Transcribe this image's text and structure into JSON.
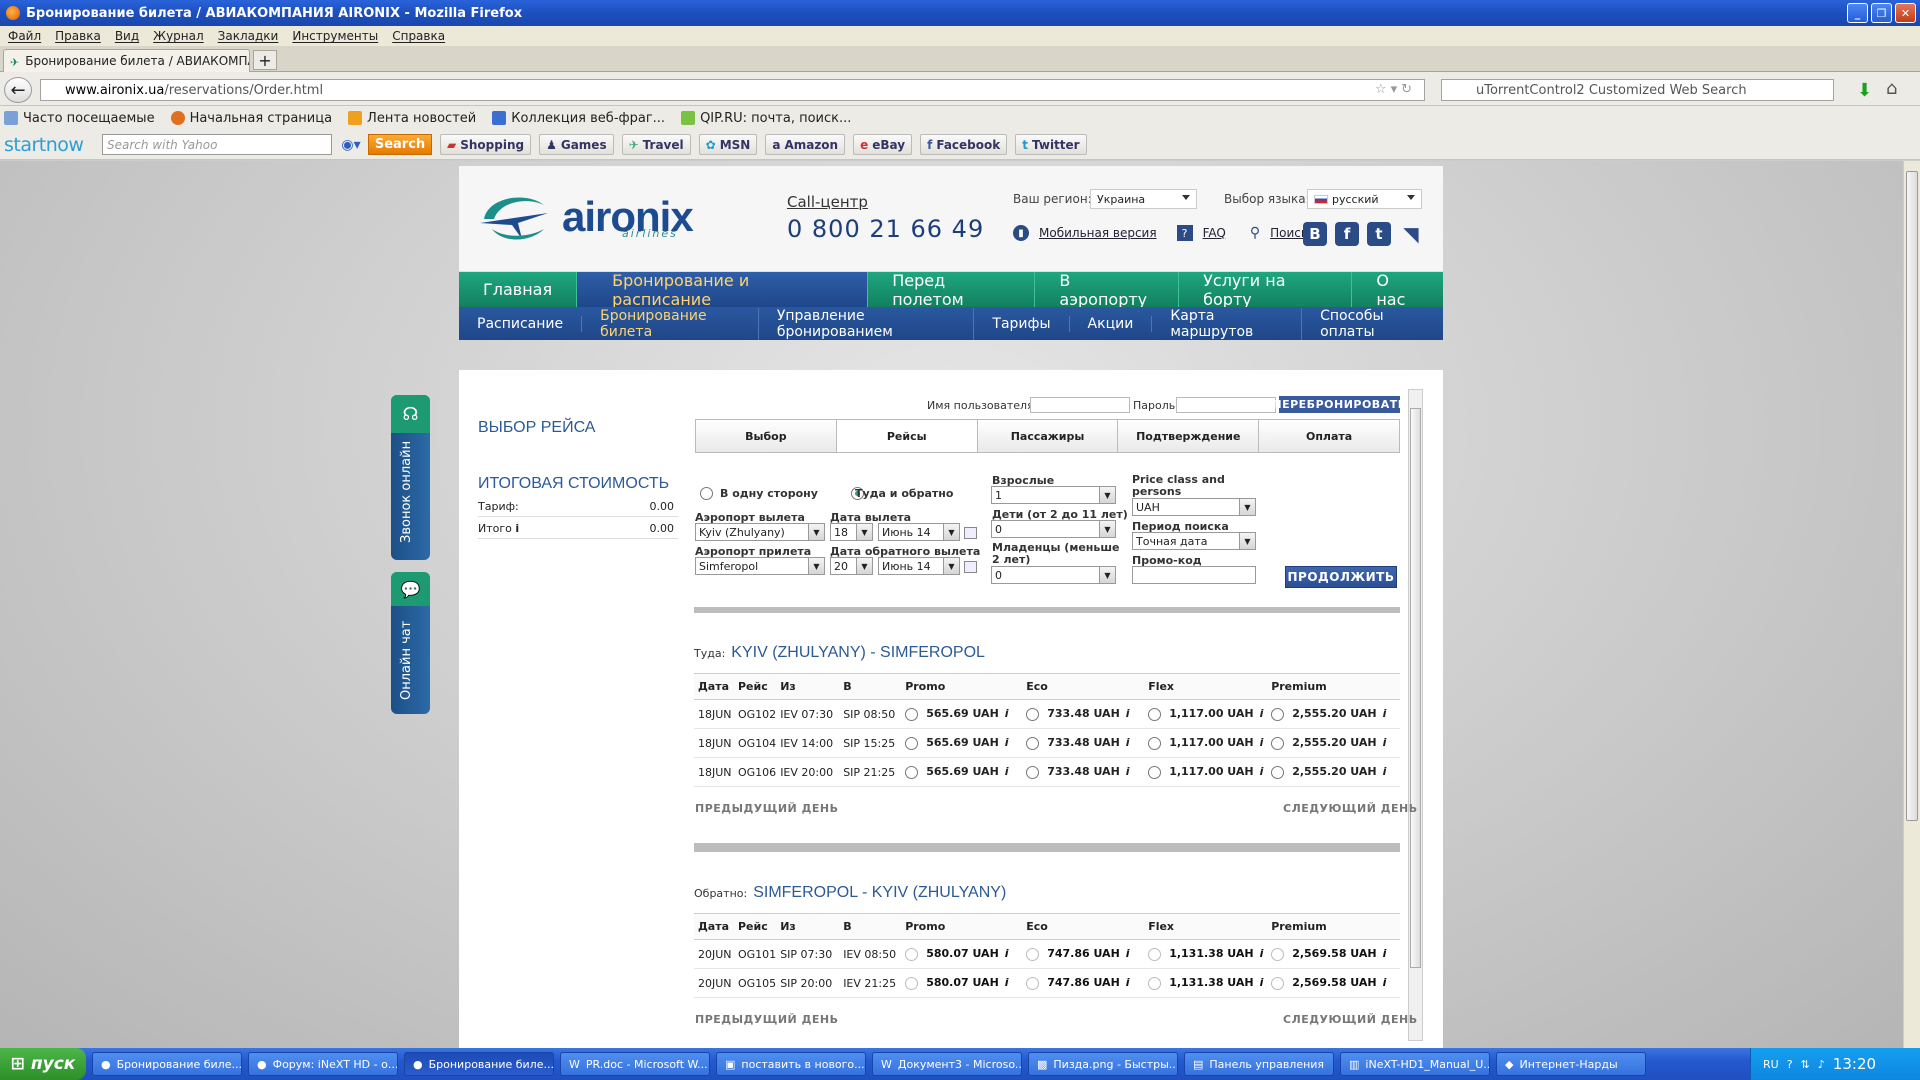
{
  "window": {
    "title": "Бронирование билета / АВИАКОМПАНИЯ AIRONIX - Mozilla Firefox"
  },
  "menu": [
    "Файл",
    "Правка",
    "Вид",
    "Журнал",
    "Закладки",
    "Инструменты",
    "Справка"
  ],
  "tab": {
    "label": "Бронирование билета / АВИАКОМПАНИЯ ..."
  },
  "address": {
    "domain": "www.aironix.ua",
    "path": "/reservations/Order.html"
  },
  "search": {
    "placeholder": "uTorrentControl2 Customized Web Search"
  },
  "bookmarks": [
    "Часто посещаемые",
    "Начальная страница",
    "Лента новостей",
    "Коллекция веб-фраг...",
    "QIP.RU: почта, поиск..."
  ],
  "startnow": {
    "logo": "startnow",
    "placeholder": "Search with Yahoo",
    "button": "Search",
    "links": [
      "Shopping",
      "Games",
      "Travel",
      "MSN",
      "Amazon",
      "eBay",
      "Facebook",
      "Twitter"
    ]
  },
  "site": {
    "logo": "aironix",
    "logo_sub": "airlines",
    "call_label": "Call-центр",
    "phone": "0 800 21 66 49",
    "region_label": "Ваш регион:",
    "region_value": "Украина",
    "lang_label": "Выбор языка:",
    "lang_value": "русский",
    "mobile": "Мобильная версия",
    "faq": "FAQ",
    "search": "Поиск",
    "main_menu": [
      "Главная",
      "Бронирование и расписание",
      "Перед полетом",
      "В аэропорту",
      "Услуги на борту",
      "О нас"
    ],
    "sub_menu": [
      "Расписание",
      "Бронирование билета",
      "Управление бронированием",
      "Тарифы",
      "Акции",
      "Карта маршрутов",
      "Способы оплаты"
    ]
  },
  "side": {
    "call": "Звонок онлайн",
    "chat": "Онлайн чат"
  },
  "booking": {
    "title": "ВЫБОР РЕЙСА",
    "total_title": "ИТОГОВАЯ СТОИМОСТЬ",
    "tariff_label": "Тариф:",
    "tariff_value": "0.00",
    "total_label": "Итого",
    "total_value": "0.00",
    "username_label": "Имя пользователя",
    "password_label": "Пароль",
    "rebook": "ПЕРЕБРОНИРОВАТЬ",
    "steps": [
      "Выбор",
      "Рейсы",
      "Пассажиры",
      "Подтверждение",
      "Оплата"
    ],
    "one_way": "В одну сторону",
    "round_trip": "Туда и обратно",
    "dep_airport_label": "Аэропорт вылета",
    "dep_airport": "Kyiv (Zhulyany)",
    "dep_date_label": "Дата вылета",
    "dep_day": "18",
    "dep_month": "Июнь 14",
    "arr_airport_label": "Аэропорт прилета",
    "arr_airport": "Simferopol",
    "ret_date_label": "Дата обратного вылета",
    "ret_day": "20",
    "ret_month": "Июнь 14",
    "adults_label": "Взрослые",
    "adults": "1",
    "children_label": "Дети (от 2 до 11 лет)",
    "children": "0",
    "infants_label": "Младенцы (меньше 2 лет)",
    "infants": "0",
    "price_class_label": "Price class and persons",
    "currency": "UAH",
    "period_label": "Период поиска",
    "period": "Точная дата",
    "promo_label": "Промо-код",
    "continue": "ПРОДОЛЖИТЬ",
    "prev_day": "ПРЕДЫДУЩИЙ ДЕНЬ",
    "next_day": "СЛЕДУЮЩИЙ ДЕНЬ"
  },
  "table_headers": [
    "Дата",
    "Рейс",
    "Из",
    "В",
    "Promo",
    "Eco",
    "Flex",
    "Premium"
  ],
  "outbound": {
    "label": "Туда:",
    "route": "KYIV (ZHULYANY) - SIMFEROPOL",
    "rows": [
      [
        "18JUN",
        "OG102",
        "IEV 07:30",
        "SIP 08:50",
        "565.69 UAH",
        "733.48 UAH",
        "1,117.00 UAH",
        "2,555.20 UAH"
      ],
      [
        "18JUN",
        "OG104",
        "IEV 14:00",
        "SIP 15:25",
        "565.69 UAH",
        "733.48 UAH",
        "1,117.00 UAH",
        "2,555.20 UAH"
      ],
      [
        "18JUN",
        "OG106",
        "IEV 20:00",
        "SIP 21:25",
        "565.69 UAH",
        "733.48 UAH",
        "1,117.00 UAH",
        "2,555.20 UAH"
      ]
    ]
  },
  "inbound": {
    "label": "Обратно:",
    "route": "SIMFEROPOL - KYIV (ZHULYANY)",
    "rows": [
      [
        "20JUN",
        "OG101",
        "SIP 07:30",
        "IEV 08:50",
        "580.07 UAH",
        "747.86 UAH",
        "1,131.38 UAH",
        "2,569.58 UAH"
      ],
      [
        "20JUN",
        "OG105",
        "SIP 20:00",
        "IEV 21:25",
        "580.07 UAH",
        "747.86 UAH",
        "1,131.38 UAH",
        "2,569.58 UAH"
      ]
    ]
  },
  "taskbar": {
    "start": "пуск",
    "items": [
      "Бронирование биле...",
      "Форум: iNeXT HD - о...",
      "Бронирование биле...",
      "PR.doc - Microsoft W...",
      "поставить в нового...",
      "Документ3 - Microso...",
      "Пизда.png - Быстры...",
      "Панель управления",
      "iNeXT-HD1_Manual_U...",
      "Интернет-Нарды"
    ],
    "lang": "RU",
    "time": "13:20"
  }
}
